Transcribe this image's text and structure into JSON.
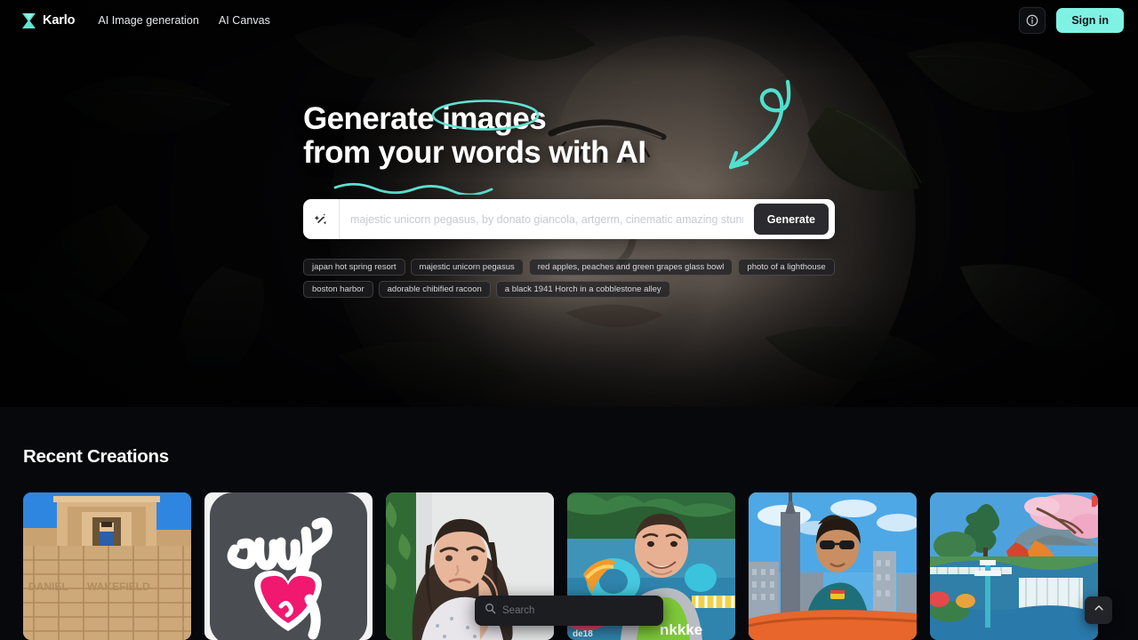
{
  "navbar": {
    "brand_name": "Karlo",
    "brand_icon": "hourglass-logo-icon",
    "links": [
      {
        "label": "AI Image generation"
      },
      {
        "label": "AI Canvas"
      }
    ],
    "info_icon": "info-circle-icon",
    "signin_label": "Sign in",
    "accent_color": "#7ff2e3"
  },
  "hero": {
    "headline_line1_prefix": "Generate ",
    "headline_line1_circled": "images",
    "headline_line2": "from your words with AI",
    "doodle_accent_color": "#5fe3d2",
    "prompt": {
      "wand_icon": "magic-wand-icon",
      "value": "",
      "placeholder": "majestic unicorn pegasus, by donato giancola, artgerm, cinematic amazing stunning, intricate",
      "generate_label": "Generate"
    },
    "chips": [
      {
        "label": "japan hot spring resort"
      },
      {
        "label": "majestic unicorn pegasus"
      },
      {
        "label": "red apples, peaches and green grapes glass bowl"
      },
      {
        "label": "photo of a lighthouse"
      },
      {
        "label": "boston harbor"
      },
      {
        "label": "adorable chibified racoon"
      },
      {
        "label": "a black 1941 Horch in a cobblestone alley"
      }
    ]
  },
  "recent": {
    "title": "Recent Creations",
    "cards": [
      {
        "name": "sandcastle-temple-figure"
      },
      {
        "name": "owij-heart-logo-sticker"
      },
      {
        "name": "worried-woman-portrait"
      },
      {
        "name": "smiling-man-poolside"
      },
      {
        "name": "man-rooftop-skyline"
      },
      {
        "name": "japanese-garden-waterfall"
      }
    ]
  },
  "overlay": {
    "search_icon": "search-icon",
    "search_value": "",
    "search_placeholder": "Search",
    "to_top_icon": "chevron-up-icon"
  }
}
